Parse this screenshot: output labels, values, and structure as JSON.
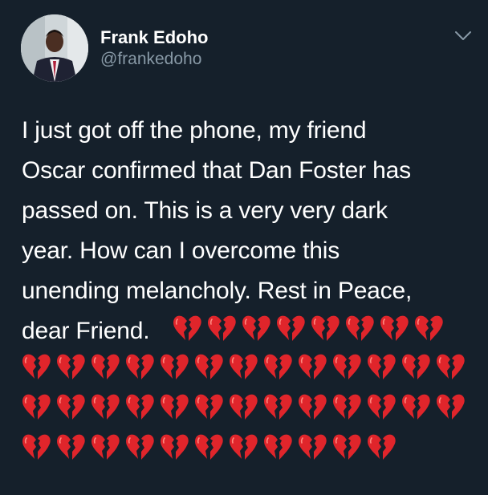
{
  "tweet": {
    "display_name": "Frank Edoho",
    "handle": "@frankedoho",
    "text_lines": [
      "I just got off the phone, my friend",
      "Oscar confirmed that Dan Foster has",
      "passed on. This is a very very dark",
      "year. How can I overcome this",
      "unending melancholy. Rest in Peace,",
      "dear Friend."
    ],
    "emoji": "broken-heart-icon",
    "emoji_rows": [
      8,
      13,
      13,
      11
    ]
  },
  "colors": {
    "background": "#15202b",
    "text": "#ffffff",
    "secondary_text": "#8899a6",
    "heart": "#e0252b"
  }
}
